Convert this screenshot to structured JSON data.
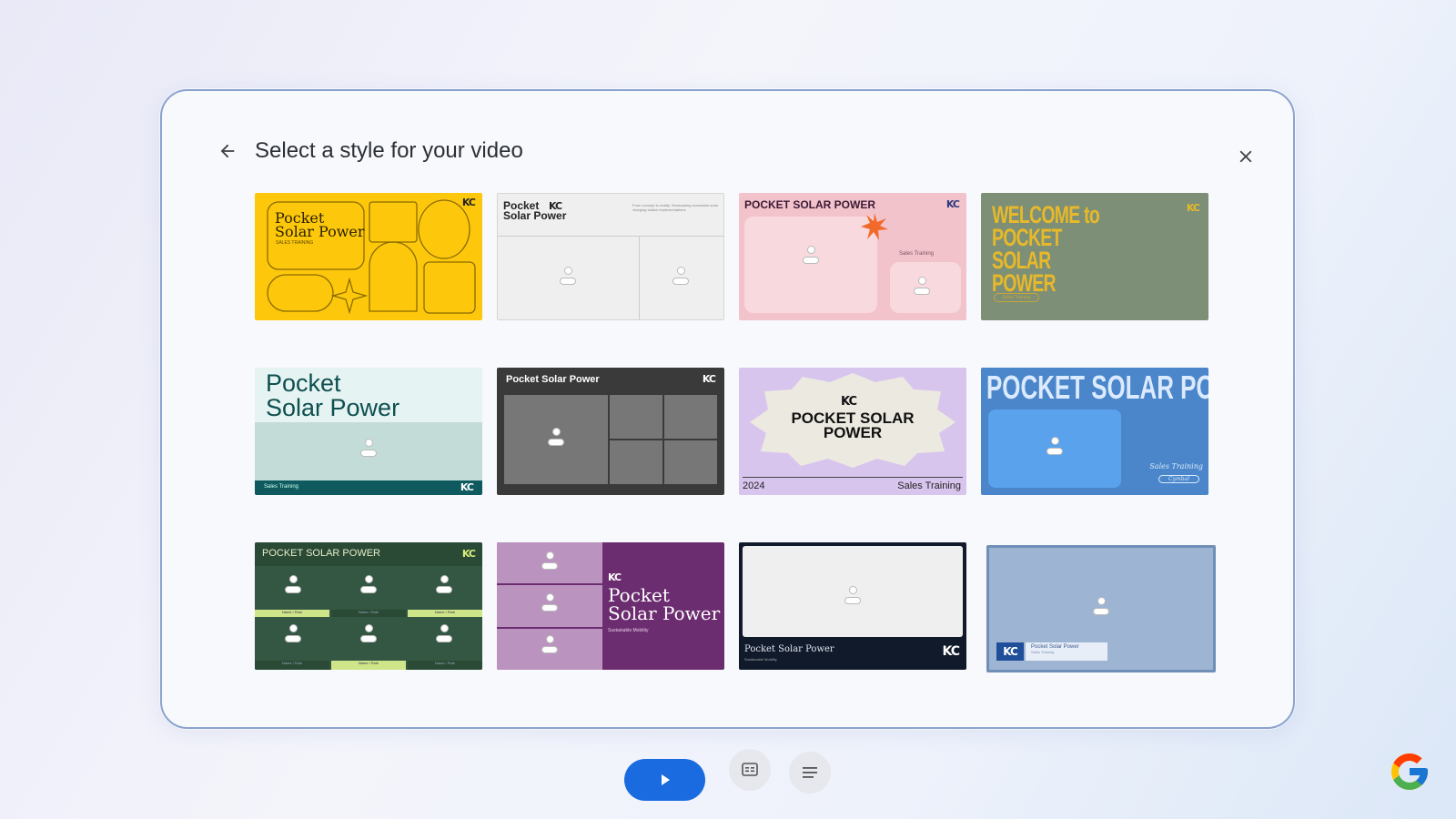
{
  "dialog": {
    "title": "Select a style for your video",
    "back_icon": "arrow-left-icon",
    "close_icon": "close-icon"
  },
  "styles": [
    {
      "name": "yellow-shapes",
      "title": "Pocket\nSolar Power",
      "subtitle": "SALES TRAINING",
      "logo": "KC"
    },
    {
      "name": "minimal-gray",
      "title": "Pocket\nSolar Power",
      "logo": "KC",
      "blurb": "From concept to reality: Showcasing successful solar charging station implementations"
    },
    {
      "name": "pink-burst",
      "title": "POCKET SOLAR POWER",
      "logo": "KC",
      "subtitle": "Sales Training"
    },
    {
      "name": "olive-welcome",
      "title": "WELCOME to POCKET SOLAR POWER",
      "logo": "KC",
      "subtitle": "Sales Training"
    },
    {
      "name": "mint-teal",
      "title": "Pocket\nSolar Power",
      "footer": "Sales Training",
      "logo": "KC"
    },
    {
      "name": "dark-grid",
      "title": "Pocket Solar Power",
      "logo": "KC"
    },
    {
      "name": "lavender-badge",
      "title": "POCKET SOLAR POWER",
      "logo": "KC",
      "year": "2024",
      "subtitle": "Sales Training"
    },
    {
      "name": "blue-bold",
      "title": "POCKET SOLAR POWER",
      "subtitle": "Sales Training",
      "tag": "Cymbal"
    },
    {
      "name": "green-team",
      "title": "POCKET SOLAR POWER",
      "logo": "KC",
      "row_label": "Name / Role"
    },
    {
      "name": "purple-serif",
      "title": "Pocket\nSolar Power",
      "subtitle": "Sustainable Mobility",
      "logo": "KC"
    },
    {
      "name": "navy-frame",
      "title": "Pocket Solar Power",
      "subtitle": "Sustainable Mobility",
      "logo": "KC"
    },
    {
      "name": "steel-blue",
      "title": "Pocket Solar Power",
      "subtitle": "Sales Training",
      "logo": "KC"
    }
  ],
  "controls": {
    "play_icon": "play-icon",
    "captions_icon": "captions-icon",
    "menu_icon": "menu-icon"
  },
  "colors": {
    "accent": "#1a6be0",
    "dialog_border": "#8aa3cf"
  }
}
